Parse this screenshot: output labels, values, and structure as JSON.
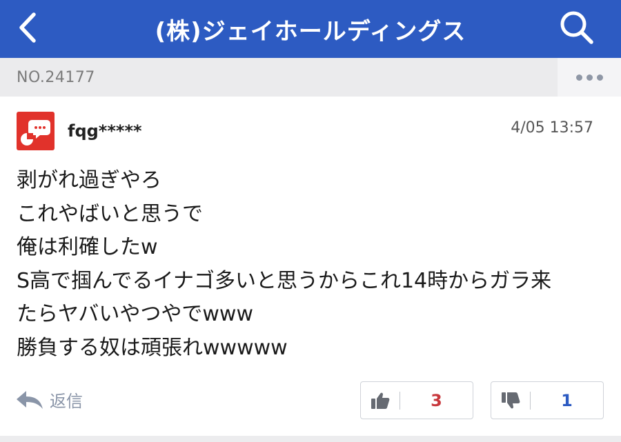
{
  "header": {
    "title": "(株)ジェイホールディングス",
    "back_icon": "chevron-left-icon",
    "search_icon": "search-icon",
    "bg_color": "#2d5bc2"
  },
  "post_bar": {
    "post_number": "NO.24177",
    "more_icon": "more-horizontal-icon"
  },
  "post": {
    "username": "fqg*****",
    "timestamp": "4/05 13:57",
    "avatar_icon": "speech-bubble-avatar-icon",
    "avatar_color": "#e1322b",
    "lines": [
      "剥がれ過ぎやろ",
      "これやばいと思うで",
      "俺は利確したw",
      "S高で掴んでるイナゴ多いと思うからこれ14時からガラ来",
      "たらヤバいやつやでwww",
      "勝負する奴は頑張れwwwww"
    ]
  },
  "actions": {
    "reply_label": "返信",
    "reply_icon": "reply-arrow-icon",
    "like_icon": "thumbs-up-icon",
    "like_count": "3",
    "like_color": "#c8383d",
    "dislike_icon": "thumbs-down-icon",
    "dislike_count": "1",
    "dislike_color": "#2d5bc2"
  }
}
